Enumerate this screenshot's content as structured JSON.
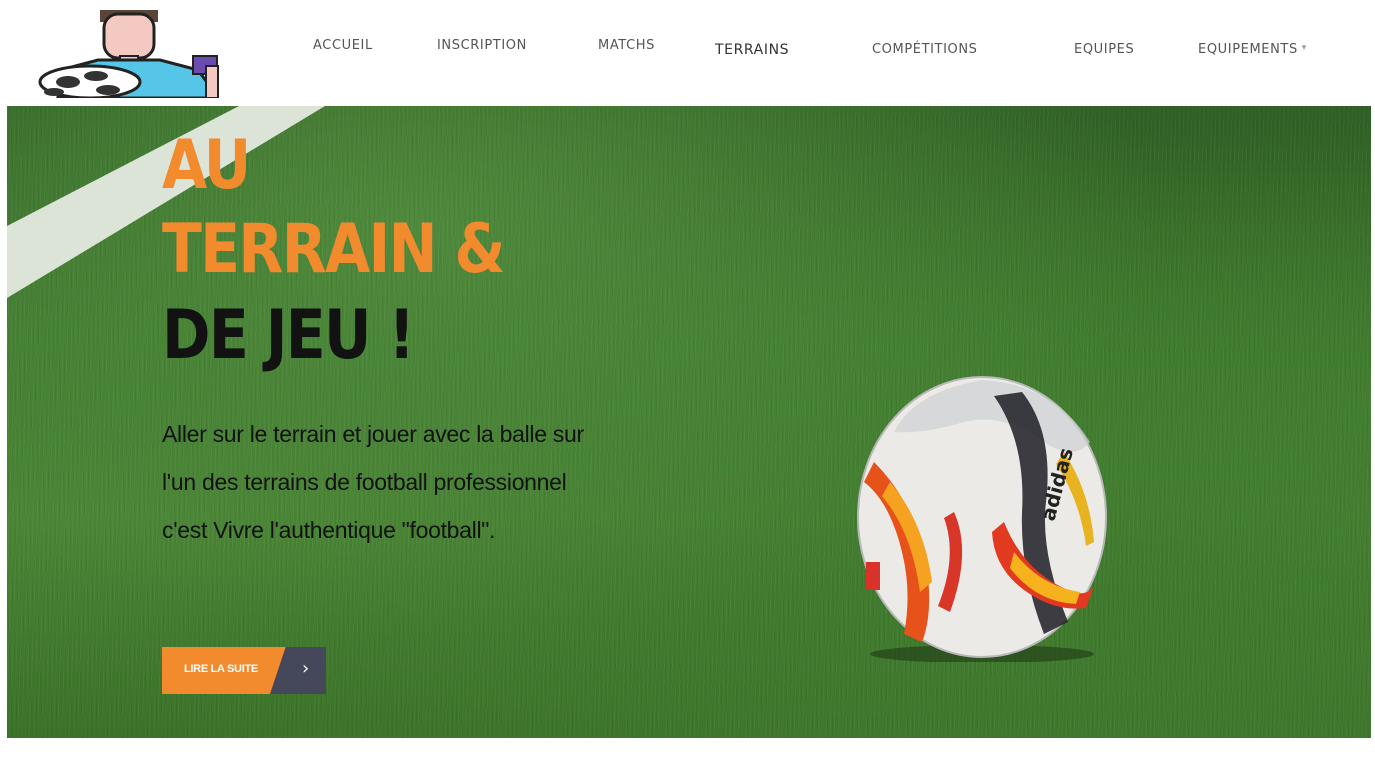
{
  "header": {
    "nav": [
      {
        "label": "ACCUEIL"
      },
      {
        "label": "INSCRIPTION"
      },
      {
        "label": "MATCHS"
      },
      {
        "label": "TERRAINS"
      },
      {
        "label": "COMPÉTITIONS"
      },
      {
        "label": "EQUIPES"
      },
      {
        "label": "EQUIPEMENTS"
      }
    ]
  },
  "hero": {
    "title_line1": "AU",
    "title_line2": "TERRAIN &",
    "title_line3": "DE JEU !",
    "text": "Aller sur le terrain et jouer avec la balle sur l'un des terrains de football professionnel c'est Vivre l'authentique \"football\".",
    "cta_label": "LIRE LA SUITE",
    "cta_icon": "chevron-right-icon",
    "ball_brand": "adidas"
  },
  "colors": {
    "accent": "#f28a2e",
    "button_dark": "#45475a",
    "title_dark": "#121212",
    "grass": "#3f7b2e"
  }
}
